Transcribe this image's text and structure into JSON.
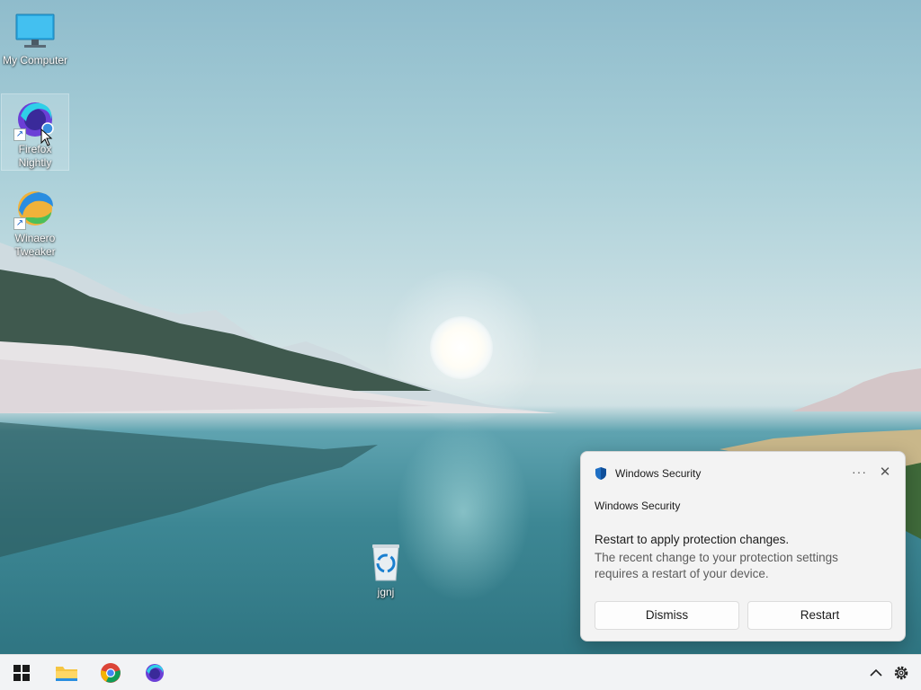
{
  "desktop": {
    "icons": [
      {
        "label": "My Computer"
      },
      {
        "label": "Firefox Nightly"
      },
      {
        "label": "Winaero Tweaker"
      },
      {
        "label": "jgnj"
      }
    ]
  },
  "notification": {
    "app_name": "Windows Security",
    "more_label": "···",
    "close_label": "✕",
    "source": "Windows Security",
    "title": "Restart to apply protection changes.",
    "body": "The recent change to your protection settings requires a restart of your device.",
    "buttons": {
      "dismiss": "Dismiss",
      "restart": "Restart"
    }
  },
  "taskbar": {
    "items": [
      {
        "icon": "windows-start-icon"
      },
      {
        "icon": "file-explorer-icon"
      },
      {
        "icon": "chrome-icon"
      },
      {
        "icon": "firefox-nightly-icon"
      }
    ],
    "tray": [
      {
        "icon": "chevron-up-icon"
      },
      {
        "icon": "gear-icon"
      }
    ]
  },
  "colors": {
    "accent": "#0078d4",
    "taskbar_bg": "#f2f3f5",
    "toast_bg": "#f3f3f3"
  }
}
